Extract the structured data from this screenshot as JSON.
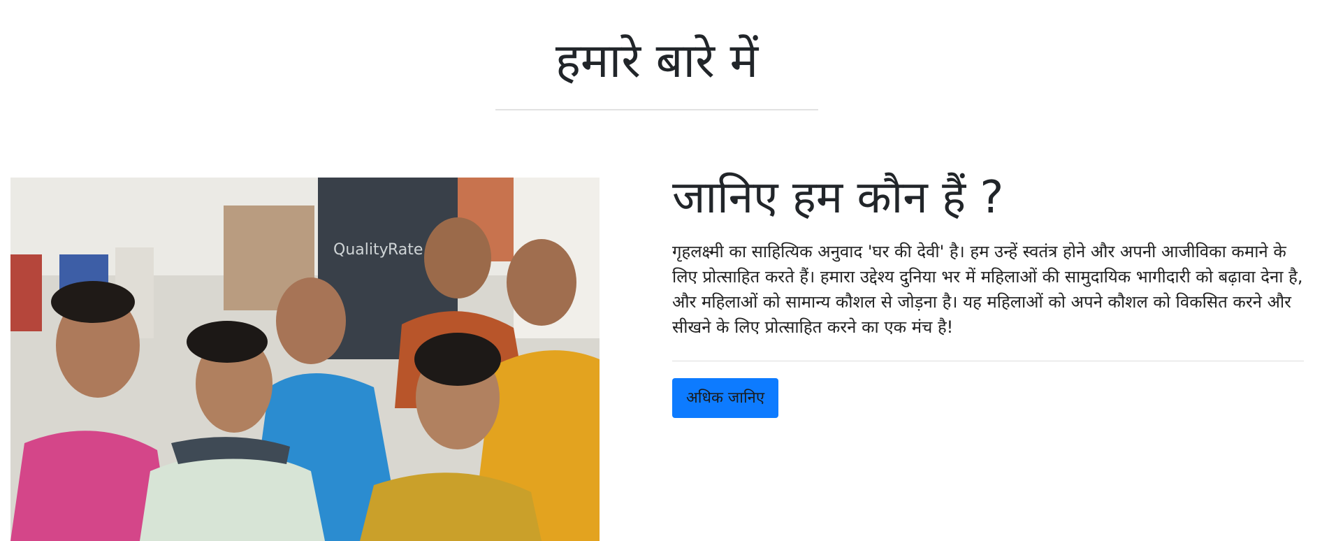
{
  "section": {
    "title": "हमारे बारे में"
  },
  "about": {
    "heading": "जानिए हम कौन हैं ?",
    "description": "गृहलक्ष्मी का साहित्यिक अनुवाद 'घर की देवी' है। हम उन्हें स्वतंत्र होने और अपनी आजीविका कमाने के लिए प्रोत्साहित करते हैं। हमारा उद्देश्य दुनिया भर में महिलाओं की सामुदायिक भागीदारी को बढ़ावा देना है, और महिलाओं को सामान्य कौशल से जोड़ना है। यह महिलाओं को अपने कौशल को विकसित करने और सीखने के लिए प्रोत्साहित करने का एक मंच है!",
    "button_label": "अधिक जानिए"
  },
  "colors": {
    "button": "#0d7bff",
    "text": "#222222",
    "rule": "#e2e2e2"
  }
}
